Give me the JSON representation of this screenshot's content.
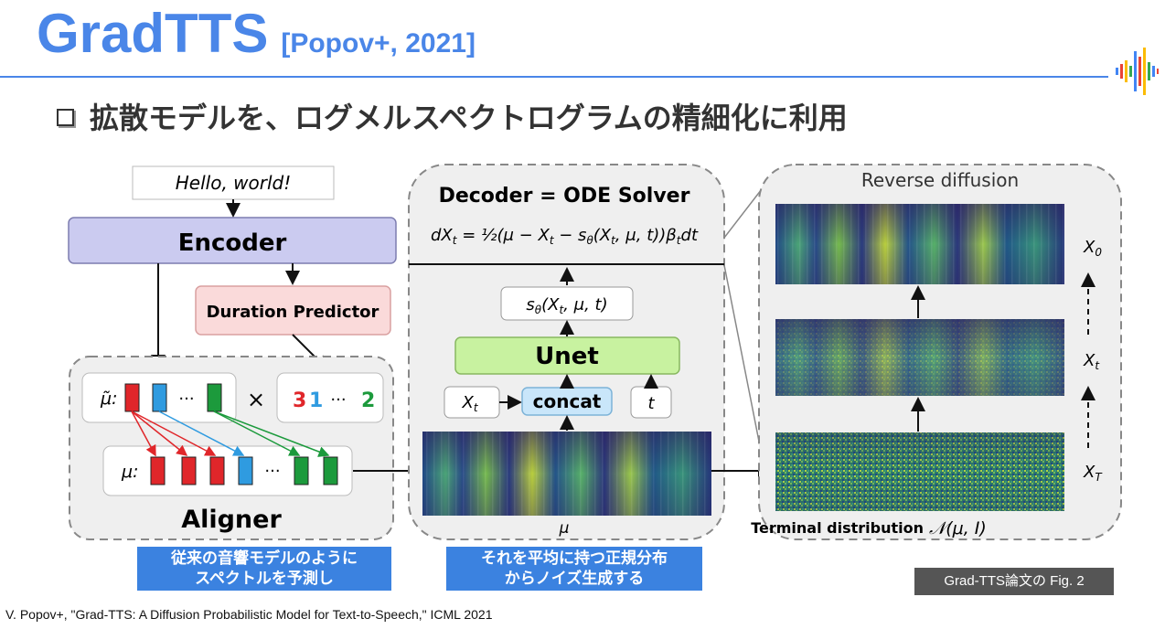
{
  "slide": {
    "title": "GradTTS",
    "title_ref": "[Popov+, 2021]",
    "bullet": "拡散モデルを、ログメルスペクトログラムの精細化に利用",
    "caption": "V. Popov+, \"Grad-TTS: A Diffusion Probabilistic Model for Text-to-Speech,\" ICML 2021",
    "callout_left": [
      "従来の音響モデルのように",
      "スペクトルを予測し"
    ],
    "callout_mid": [
      "それを平均に持つ正規分布",
      "からノイズ生成する"
    ],
    "fig_ref": "Grad-TTS論文の Fig. 2"
  },
  "diagram": {
    "input_text": "Hello, world!",
    "encoder": "Encoder",
    "duration_predictor": "Duration Predictor",
    "aligner": "Aligner",
    "mu_tilde_label": "μ̃:",
    "mu_label": "μ:",
    "ellipsis": "···",
    "times": "×",
    "durations": [
      {
        "value": "3",
        "color": "#e0262a"
      },
      {
        "value": "1",
        "color": "#2f9be0"
      },
      {
        "value": "···",
        "color": "#333333"
      },
      {
        "value": "2",
        "color": "#1c9a3c"
      }
    ],
    "decoder_title": "Decoder = ODE Solver",
    "ode_lhs": "dX",
    "ode_lhs_sub": "t",
    "ode_rhs": "= ½(μ − X",
    "ode_rhs2": "t",
    "ode_rhs3": " − s",
    "ode_rhs4": "θ",
    "ode_rhs5": "(X",
    "ode_rhs6": "t",
    "ode_rhs7": ", μ, t))β",
    "ode_rhs8": "t",
    "ode_rhs9": "dt",
    "score_main": "s",
    "score_sub": "θ",
    "score_args": "(X",
    "score_sub2": "t",
    "score_tail": ", μ, t)",
    "unet": "Unet",
    "concat": "concat",
    "xt_main": "X",
    "xt_sub": "t",
    "t_label": "t",
    "mu_spec_label": "μ",
    "reverse_diffusion": "Reverse diffusion",
    "x0_main": "X",
    "x0_sub": "0",
    "xt2_main": "X",
    "xt2_sub": "t",
    "xT_main": "X",
    "xT_sub": "T",
    "terminal_distribution": "Terminal distribution",
    "normal_symbol": "𝒩",
    "normal_args": "(μ, I)"
  },
  "colors": {
    "accent": "#4a86e8",
    "encoder": "#cbcbf0",
    "duration": "#fadada",
    "unet": "#c8f2a0",
    "concat": "#c9e6fa",
    "red": "#e0262a",
    "blue": "#2f9be0",
    "green": "#1c9a3c"
  }
}
